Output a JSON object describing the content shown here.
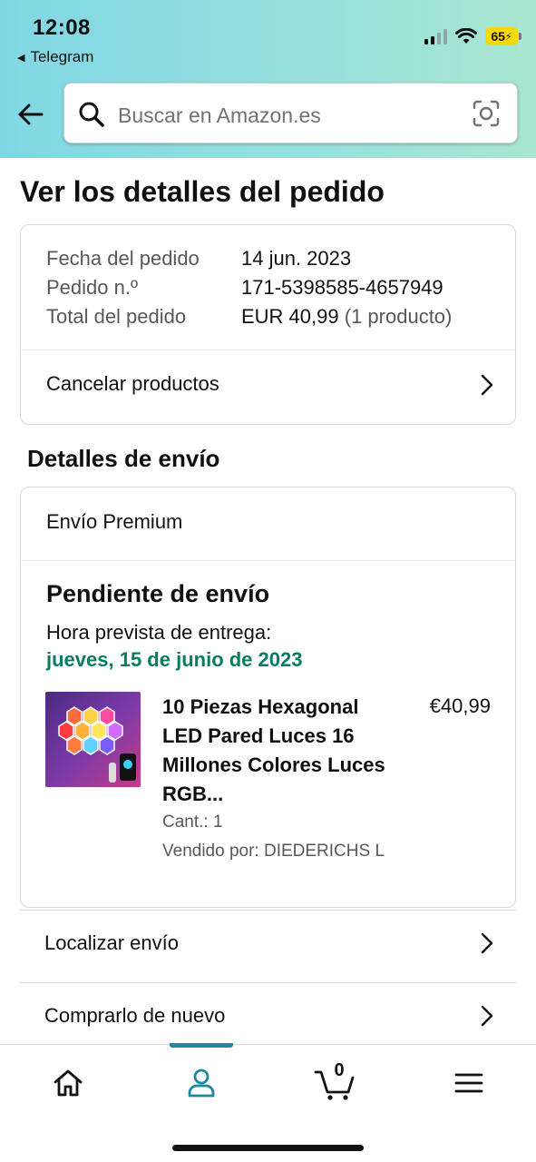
{
  "status_bar": {
    "time": "12:08",
    "back_app": "Telegram",
    "battery": "65"
  },
  "search": {
    "placeholder": "Buscar en Amazon.es"
  },
  "page_title": "Ver los detalles del pedido",
  "order_summary": {
    "date_label": "Fecha del pedido",
    "date_value": "14 jun. 2023",
    "number_label": "Pedido n.º",
    "number_value": "171-5398585-4657949",
    "total_label": "Total del pedido",
    "total_value": "EUR 40,99",
    "total_suffix": "(1 producto)",
    "cancel_link": "Cancelar productos"
  },
  "shipping": {
    "section_title": "Detalles de envío",
    "shipping_type": "Envío Premium",
    "status": "Pendiente de envío",
    "eta_label": "Hora prevista de entrega:",
    "eta_date": "jueves, 15 de junio de 2023",
    "product": {
      "title": "10 Piezas Hexagonal LED Pared Luces 16 Millones Colores Luces RGB...",
      "price": "€40,99",
      "quantity": "Cant.: 1",
      "seller": "Vendido por: DIEDERICHS L"
    }
  },
  "actions": {
    "track": "Localizar envío",
    "buy_again": "Comprarlo de nuevo"
  },
  "tabbar": {
    "cart_count": "0",
    "active_color": "#1b8a9f"
  }
}
